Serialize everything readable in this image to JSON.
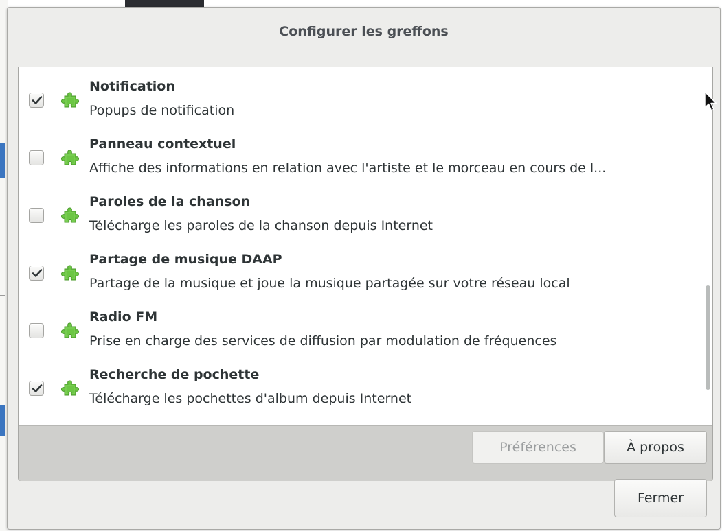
{
  "dialog": {
    "title": "Configurer les greffons"
  },
  "plugins": [
    {
      "name": "Notification",
      "description": "Popups de notification",
      "enabled": true,
      "icon": "puzzle-piece-icon"
    },
    {
      "name": "Panneau contextuel",
      "description": "Affiche des informations en relation avec l'artiste et le morceau en cours de l...",
      "enabled": false,
      "icon": "puzzle-piece-icon"
    },
    {
      "name": "Paroles de la chanson",
      "description": "Télécharge les paroles de la chanson depuis Internet",
      "enabled": false,
      "icon": "puzzle-piece-icon"
    },
    {
      "name": "Partage de musique DAAP",
      "description": "Partage de la musique et joue la musique partagée sur votre réseau local",
      "enabled": true,
      "icon": "puzzle-piece-icon"
    },
    {
      "name": "Radio FM",
      "description": "Prise en charge des services de diffusion par modulation de fréquences",
      "enabled": false,
      "icon": "puzzle-piece-icon"
    },
    {
      "name": "Recherche de pochette",
      "description": "Télécharge les pochettes d'album depuis Internet",
      "enabled": true,
      "icon": "puzzle-piece-icon"
    }
  ],
  "actions": {
    "preferences_label": "Préférences",
    "preferences_enabled": false,
    "about_label": "À propos"
  },
  "footer": {
    "close_label": "Fermer"
  },
  "colors": {
    "plugin_icon": "#6cc644",
    "dialog_bg": "#ededeb",
    "actionbar_bg": "#cfcfcc"
  }
}
